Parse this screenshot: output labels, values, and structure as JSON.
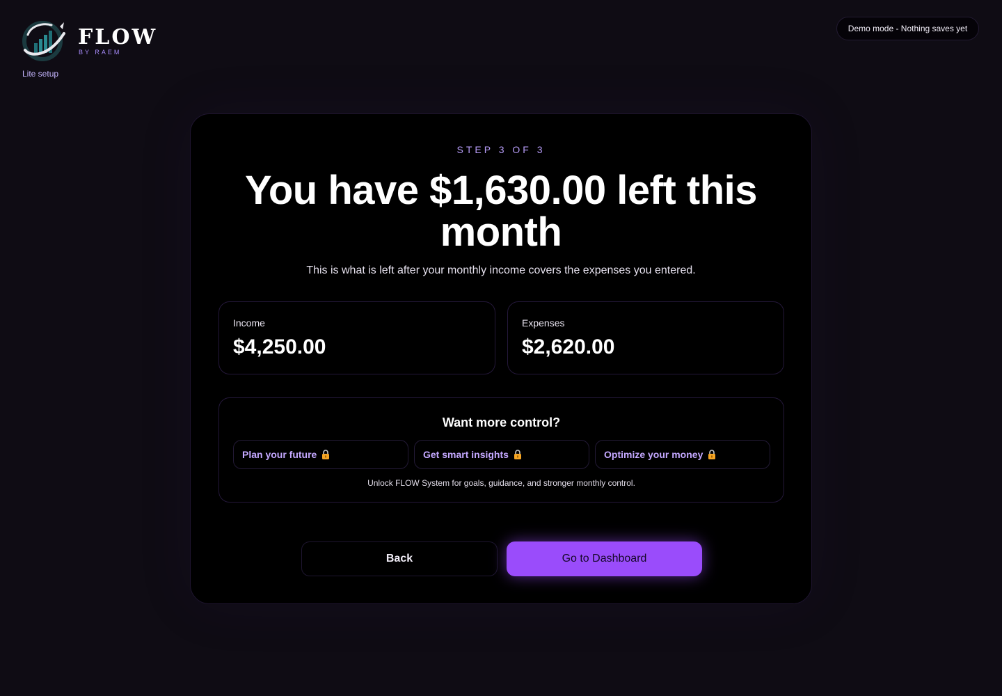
{
  "brand": {
    "name": "FLOW",
    "byline": "BY RAEM",
    "mode_label": "Lite setup"
  },
  "demo_badge": "Demo mode - Nothing saves yet",
  "step": {
    "label": "STEP 3 OF 3",
    "headline": "You have $1,630.00 left this month",
    "subtitle": "This is what is left after your monthly income covers the expenses you entered."
  },
  "summary": {
    "income": {
      "label": "Income",
      "value": "$4,250.00"
    },
    "expenses": {
      "label": "Expenses",
      "value": "$2,620.00"
    }
  },
  "upsell": {
    "title": "Want more control?",
    "features": [
      {
        "label": "Plan your future",
        "icon": "lock-icon"
      },
      {
        "label": "Get smart insights",
        "icon": "lock-icon"
      },
      {
        "label": "Optimize your money",
        "icon": "lock-icon"
      }
    ],
    "note": "Unlock FLOW System for goals, guidance, and stronger monthly control."
  },
  "actions": {
    "back_label": "Back",
    "primary_label": "Go to Dashboard"
  },
  "colors": {
    "background": "#0f0c14",
    "card": "#000000",
    "accent": "#9a4cfb",
    "accent_text": "#c4a8ff",
    "step_text": "#b69cf7",
    "lock": "#f5a524"
  }
}
